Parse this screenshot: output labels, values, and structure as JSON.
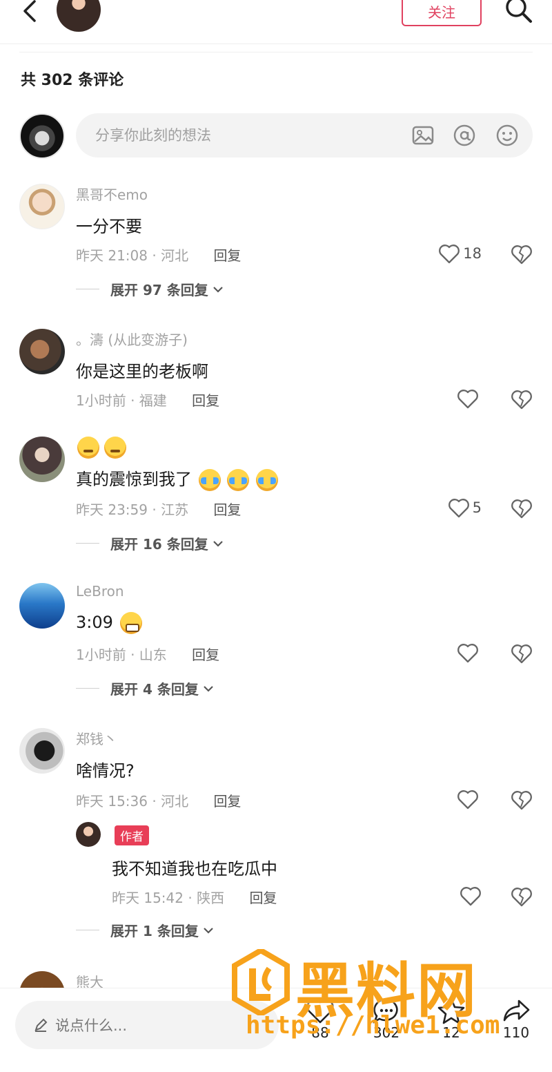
{
  "header": {
    "follow_label": "关注"
  },
  "comments_title": "共 302 条评论",
  "composer": {
    "placeholder": "分享你此刻的想法",
    "icons": [
      "image-icon",
      "at-icon",
      "emoji-icon"
    ]
  },
  "comments": [
    {
      "user": "黑哥不emo",
      "text": "一分不要",
      "time_location": "昨天 21:08 · 河北",
      "reply_label": "回复",
      "likes": "18",
      "expand_label": "展开 97 条回复"
    },
    {
      "user": "。濤 (从此变游子)",
      "text": "你是这里的老板啊",
      "time_location": "1小时前 · 福建",
      "reply_label": "回复",
      "likes": ""
    },
    {
      "user_emoji": [
        "thinking-face-emoji",
        "thinking-face-emoji"
      ],
      "text": "真的震惊到我了",
      "text_emoji": [
        "crying-laughing-emoji",
        "crying-laughing-emoji",
        "crying-laughing-emoji"
      ],
      "time_location": "昨天 23:59 · 江苏",
      "reply_label": "回复",
      "likes": "5",
      "expand_label": "展开 16 条回复"
    },
    {
      "user": "LeBron",
      "text": "3:09",
      "text_emoji": [
        "grinning-sweat-emoji"
      ],
      "time_location": "1小时前 · 山东",
      "reply_label": "回复",
      "likes": "",
      "expand_label": "展开 4 条回复"
    },
    {
      "user": "郑钱丶",
      "text": "啥情况?",
      "time_location": "昨天 15:36 · 河北",
      "reply_label": "回复",
      "likes": "",
      "reply": {
        "badge": "作者",
        "text": "我不知道我也在吃瓜中",
        "time_location": "昨天 15:42 · 陕西",
        "reply_label": "回复"
      },
      "expand_label": "展开 1 条回复"
    },
    {
      "user": "熊大"
    }
  ],
  "bottom_bar": {
    "input_label": "说点什么...",
    "likes": "88",
    "comments": "302",
    "favorites": "12",
    "shares": "110"
  },
  "watermark": {
    "text": "黑料网",
    "url": "https://hlwe1.com"
  },
  "colors": {
    "accent": "#e0415f",
    "author_badge": "#e83e57",
    "watermark": "#f7a21b"
  }
}
